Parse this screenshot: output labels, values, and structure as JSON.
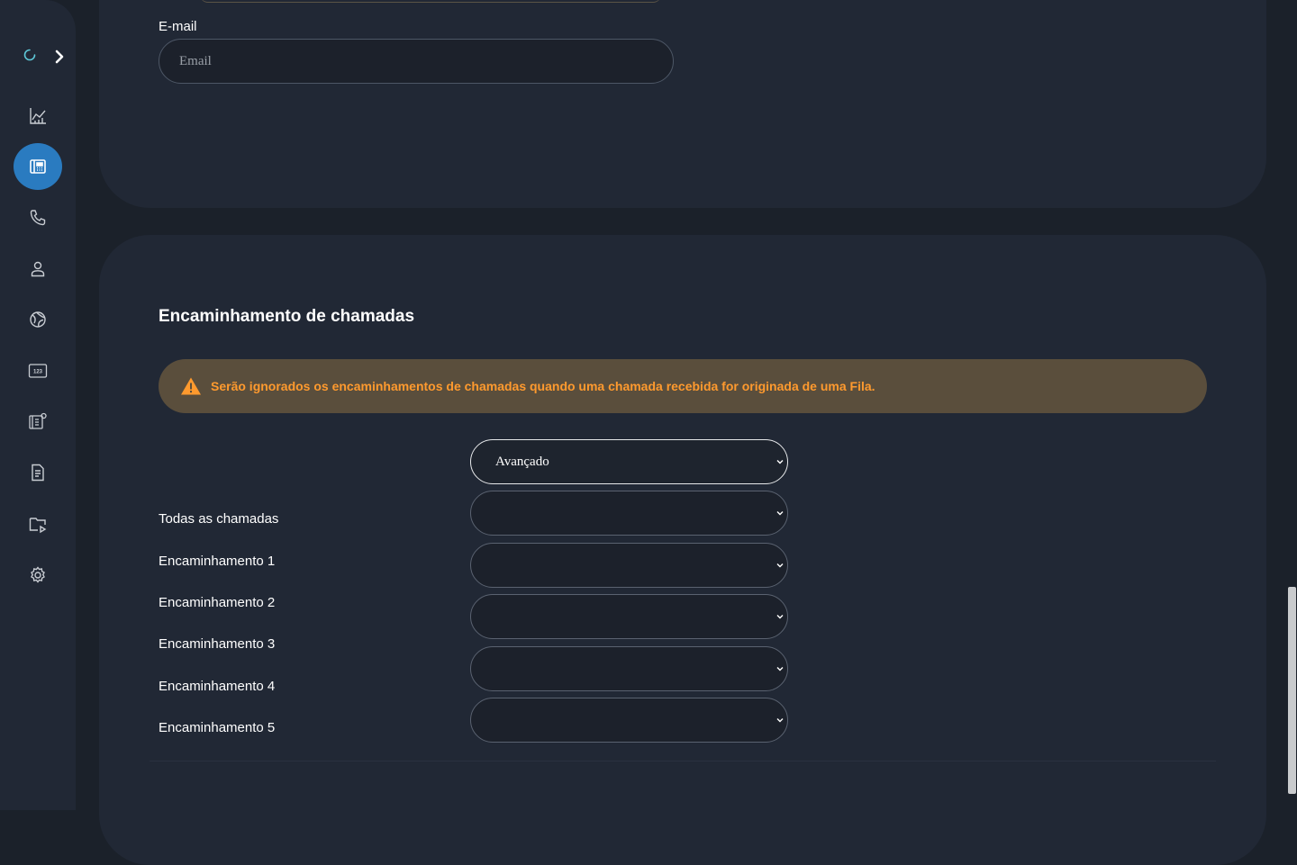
{
  "sidebar": {
    "items": [
      {
        "icon": "chart-icon"
      },
      {
        "icon": "pbx-device-icon",
        "active": true
      },
      {
        "icon": "phone-icon"
      },
      {
        "icon": "user-icon"
      },
      {
        "icon": "globe-icon"
      },
      {
        "icon": "numbers-123-icon"
      },
      {
        "icon": "device-settings-icon"
      },
      {
        "icon": "document-icon"
      },
      {
        "icon": "media-folder-icon"
      },
      {
        "icon": "gear-icon"
      }
    ]
  },
  "contact": {
    "email_label": "E-mail",
    "email_placeholder": "Email",
    "email_value": ""
  },
  "forwarding": {
    "title": "Encaminhamento de chamadas",
    "warning": "Serão ignorados os encaminhamentos de chamadas quando uma chamada recebida for originada de uma Fila.",
    "mode": "Avançado",
    "rows": [
      {
        "label": "Todas as chamadas",
        "value": ""
      },
      {
        "label": "Encaminhamento 1",
        "value": ""
      },
      {
        "label": "Encaminhamento 2",
        "value": ""
      },
      {
        "label": "Encaminhamento 3",
        "value": ""
      },
      {
        "label": "Encaminhamento 4",
        "value": ""
      },
      {
        "label": "Encaminhamento 5",
        "value": ""
      }
    ]
  },
  "colors": {
    "accent": "#2a7bc0",
    "warning_bg": "#5a4e3c",
    "warning_text": "#ff9a2e",
    "card_bg": "#212835",
    "page_bg": "#1b212a"
  }
}
